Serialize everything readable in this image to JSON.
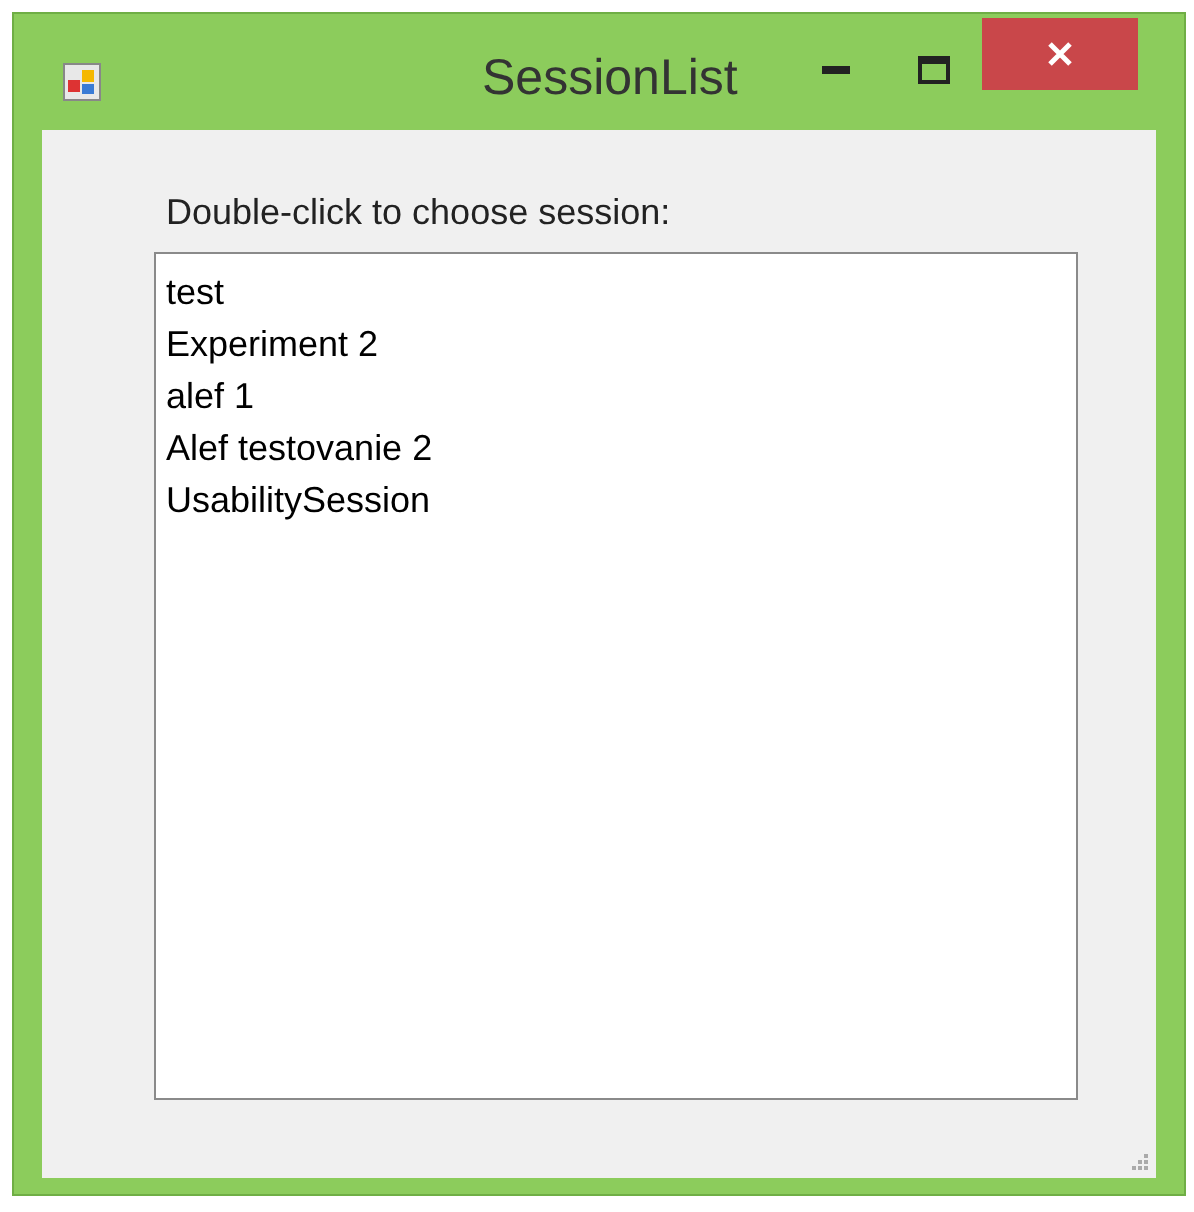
{
  "window": {
    "title": "SessionList"
  },
  "label": "Double-click to choose session:",
  "sessions": [
    {
      "name": "test"
    },
    {
      "name": "Experiment 2"
    },
    {
      "name": "alef 1"
    },
    {
      "name": "Alef testovanie 2"
    },
    {
      "name": "UsabilitySession"
    }
  ]
}
